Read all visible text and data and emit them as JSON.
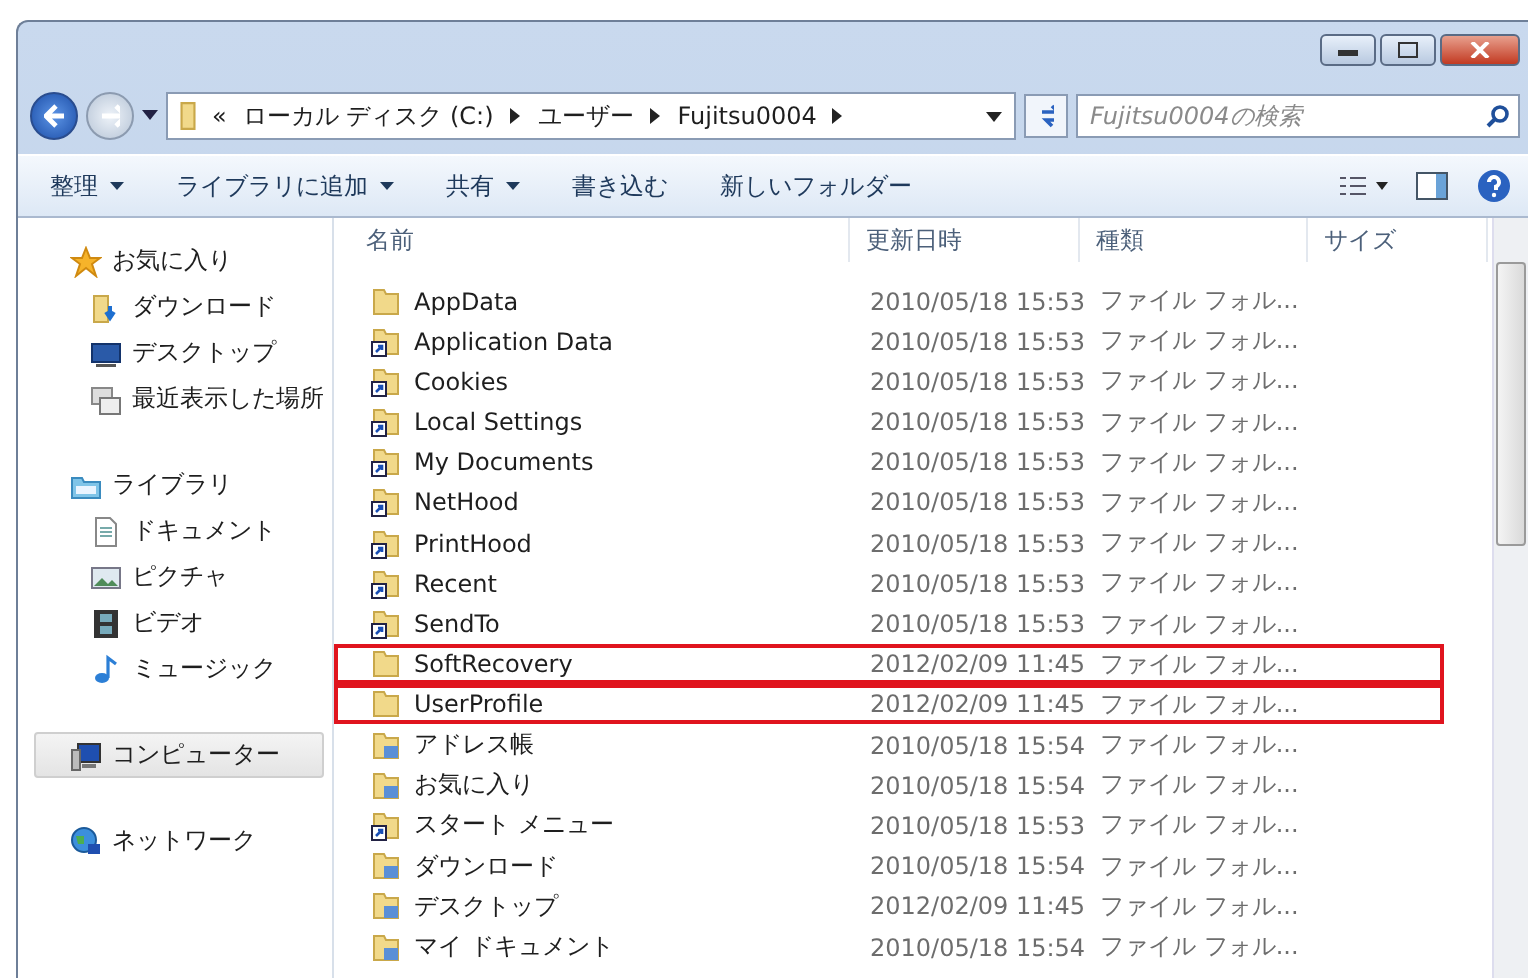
{
  "address": {
    "crumbs": [
      "«",
      "ローカル ディスク (C:)",
      "ユーザー",
      "Fujitsu0004"
    ]
  },
  "search": {
    "placeholder": "Fujitsu0004の検索"
  },
  "toolbar": [
    {
      "label": "整理",
      "dropdown": true
    },
    {
      "label": "ライブラリに追加",
      "dropdown": true
    },
    {
      "label": "共有",
      "dropdown": true
    },
    {
      "label": "書き込む",
      "dropdown": false
    },
    {
      "label": "新しいフォルダー",
      "dropdown": false
    }
  ],
  "sidebar": {
    "groups": [
      {
        "label": "お気に入り",
        "kind": "favorites",
        "selected": false,
        "children": [
          {
            "label": "ダウンロード",
            "kind": "downloads",
            "selected": false
          },
          {
            "label": "デスクトップ",
            "kind": "desktop",
            "selected": false
          },
          {
            "label": "最近表示した場所",
            "kind": "recent",
            "selected": false
          }
        ]
      },
      {
        "label": "ライブラリ",
        "kind": "library",
        "selected": false,
        "children": [
          {
            "label": "ドキュメント",
            "kind": "documents",
            "selected": false
          },
          {
            "label": "ピクチャ",
            "kind": "pictures",
            "selected": false
          },
          {
            "label": "ビデオ",
            "kind": "video",
            "selected": false
          },
          {
            "label": "ミュージック",
            "kind": "music",
            "selected": false
          }
        ]
      },
      {
        "label": "コンピューター",
        "kind": "computer",
        "selected": true
      },
      {
        "label": "ネットワーク",
        "kind": "network",
        "selected": false
      }
    ]
  },
  "table": {
    "columns": [
      "名前",
      "更新日時",
      "種類",
      "サイズ"
    ],
    "rows": [
      {
        "name": "AppData",
        "modified": "2010/05/18 15:53",
        "type": "ファイル フォル...",
        "kind": "folder",
        "highlighted": false
      },
      {
        "name": "Application Data",
        "modified": "2010/05/18 15:53",
        "type": "ファイル フォル...",
        "kind": "shortcut",
        "highlighted": false
      },
      {
        "name": "Cookies",
        "modified": "2010/05/18 15:53",
        "type": "ファイル フォル...",
        "kind": "shortcut",
        "highlighted": false
      },
      {
        "name": "Local Settings",
        "modified": "2010/05/18 15:53",
        "type": "ファイル フォル...",
        "kind": "shortcut",
        "highlighted": false
      },
      {
        "name": "My Documents",
        "modified": "2010/05/18 15:53",
        "type": "ファイル フォル...",
        "kind": "shortcut",
        "highlighted": false
      },
      {
        "name": "NetHood",
        "modified": "2010/05/18 15:53",
        "type": "ファイル フォル...",
        "kind": "shortcut",
        "highlighted": false
      },
      {
        "name": "PrintHood",
        "modified": "2010/05/18 15:53",
        "type": "ファイル フォル...",
        "kind": "shortcut",
        "highlighted": false
      },
      {
        "name": "Recent",
        "modified": "2010/05/18 15:53",
        "type": "ファイル フォル...",
        "kind": "shortcut",
        "highlighted": false
      },
      {
        "name": "SendTo",
        "modified": "2010/05/18 15:53",
        "type": "ファイル フォル...",
        "kind": "shortcut",
        "highlighted": false
      },
      {
        "name": "SoftRecovery",
        "modified": "2012/02/09 11:45",
        "type": "ファイル フォル...",
        "kind": "folder",
        "highlighted": true
      },
      {
        "name": "UserProfile",
        "modified": "2012/02/09 11:45",
        "type": "ファイル フォル...",
        "kind": "folder",
        "highlighted": true
      },
      {
        "name": "アドレス帳",
        "modified": "2010/05/18 15:54",
        "type": "ファイル フォル...",
        "kind": "special",
        "highlighted": false
      },
      {
        "name": "お気に入り",
        "modified": "2010/05/18 15:54",
        "type": "ファイル フォル...",
        "kind": "special",
        "highlighted": false
      },
      {
        "name": "スタート メニュー",
        "modified": "2010/05/18 15:53",
        "type": "ファイル フォル...",
        "kind": "shortcut",
        "highlighted": false
      },
      {
        "name": "ダウンロード",
        "modified": "2010/05/18 15:54",
        "type": "ファイル フォル...",
        "kind": "special",
        "highlighted": false
      },
      {
        "name": "デスクトップ",
        "modified": "2012/02/09 11:45",
        "type": "ファイル フォル...",
        "kind": "special",
        "highlighted": false
      },
      {
        "name": "マイ ドキュメント",
        "modified": "2010/05/18 15:54",
        "type": "ファイル フォル...",
        "kind": "special",
        "highlighted": false
      }
    ]
  }
}
